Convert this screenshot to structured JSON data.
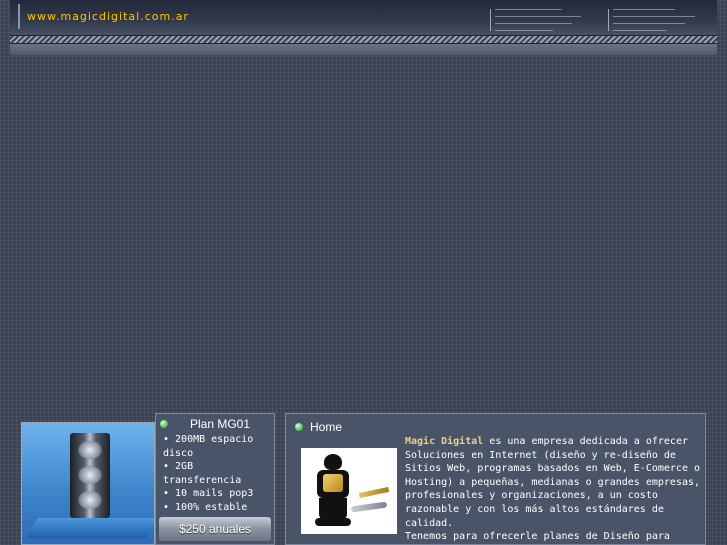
{
  "header": {
    "url": "www.magicdigital.com.ar"
  },
  "plan": {
    "title": "Plan MG01",
    "features": [
      "• 200MB espacio disco",
      "• 2GB transferencia",
      "• 10 mails pop3",
      "• 100% estable"
    ],
    "price": "$250 anuales"
  },
  "home": {
    "title": "Home",
    "brand": "Magic Digital",
    "intro": " es una empresa dedicada a ofrecer Soluciones en Internet (diseño y re-diseño de Sitios Web, programas basados en Web, E-Comerce o Hosting) a pequeñas, medianas o grandes empresas, profesionales y organizaciones, a un costo razonable y con los más altos estándares de calidad.",
    "second": "Tenemos para ofrecerle planes de Diseño para posicionar a su empresa en Internet."
  },
  "icons": {
    "bullet": "green-dot-icon"
  },
  "colors": {
    "url_text": "#ffc400",
    "background": "#3c4454",
    "panel": "#4a5468",
    "brand_text": "#e6d08e"
  }
}
